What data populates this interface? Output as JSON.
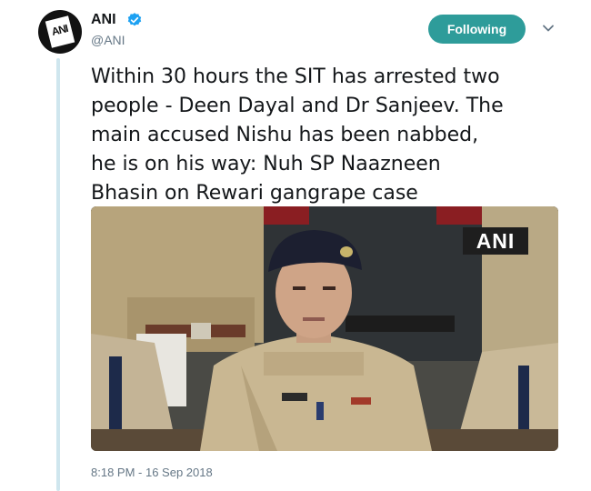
{
  "account": {
    "display_name": "ANI",
    "handle": "@ANI",
    "avatar_text": "ANI",
    "verified": true
  },
  "actions": {
    "follow_label": "Following",
    "more_icon": "chevron-down-icon"
  },
  "tweet": {
    "text": "Within 30 hours the SIT has arrested two\npeople - Deen Dayal and Dr Sanjeev. The\nmain accused Nishu has been nabbed,\nhe is on his way: Nuh SP Naazneen\nBhasin on Rewari gangrape case",
    "media": {
      "watermark": "ANI"
    },
    "timestamp": "8:18 PM - 16 Sep 2018"
  },
  "colors": {
    "follow_button": "#2e9c9a",
    "verified_badge": "#1da1f2",
    "thread_line": "#cfe6ee",
    "secondary_text": "#657786"
  }
}
